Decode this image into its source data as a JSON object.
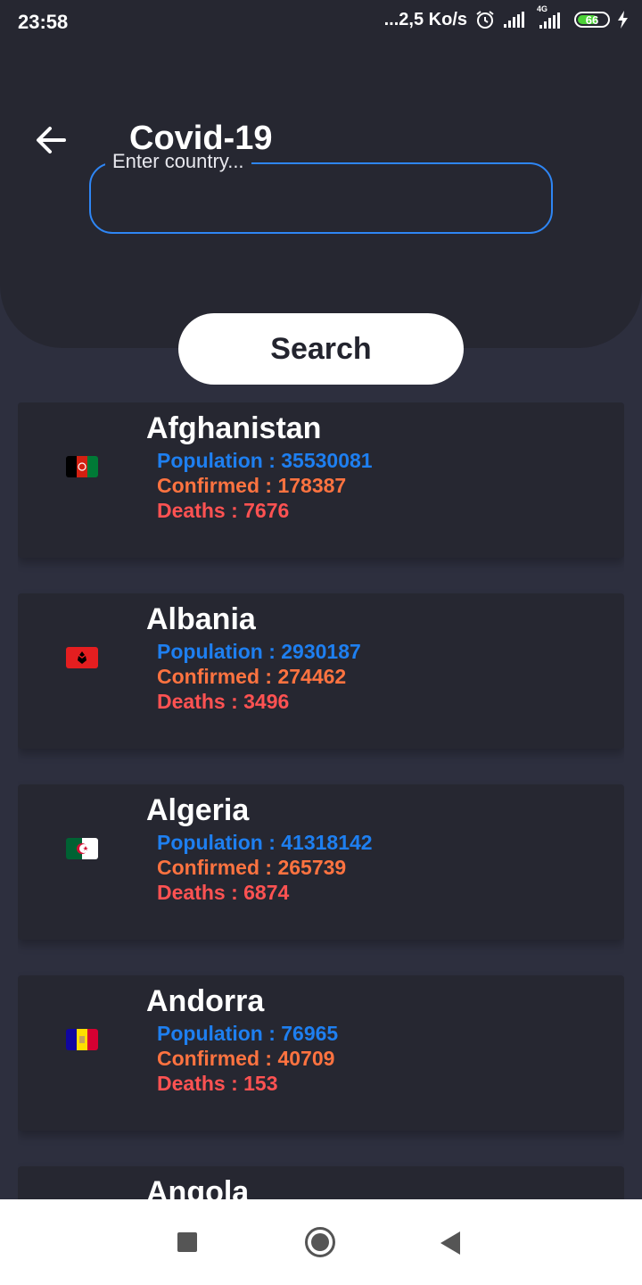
{
  "status": {
    "time": "23:58",
    "network_speed": "...2,5 Ko/s",
    "network_type": "4G",
    "battery": "66"
  },
  "header": {
    "title": "Covid-19",
    "back_icon": "arrow-left-icon"
  },
  "search": {
    "label": "Enter country...",
    "value": "",
    "button_label": "Search"
  },
  "labels": {
    "population": "Population : ",
    "confirmed": "Confirmed : ",
    "deaths": "Deaths : "
  },
  "countries": [
    {
      "name": "Afghanistan",
      "population": "35530081",
      "confirmed": "178387",
      "deaths": "7676",
      "flag": "afghanistan-flag-icon"
    },
    {
      "name": "Albania",
      "population": "2930187",
      "confirmed": "274462",
      "deaths": "3496",
      "flag": "albania-flag-icon"
    },
    {
      "name": "Algeria",
      "population": "41318142",
      "confirmed": "265739",
      "deaths": "6874",
      "flag": "algeria-flag-icon"
    },
    {
      "name": "Andorra",
      "population": "76965",
      "confirmed": "40709",
      "deaths": "153",
      "flag": "andorra-flag-icon"
    },
    {
      "name": "Angola",
      "population": "",
      "confirmed": "",
      "deaths": "",
      "flag": ""
    }
  ],
  "colors": {
    "background": "#2d2f3e",
    "header": "#262731",
    "accent": "#2e86f5",
    "population": "#1e7ff0",
    "confirmed": "#ff7340",
    "deaths": "#ff5252"
  },
  "nav": {
    "recents_icon": "square-icon",
    "home_icon": "circle-icon",
    "back_icon": "triangle-back-icon"
  }
}
